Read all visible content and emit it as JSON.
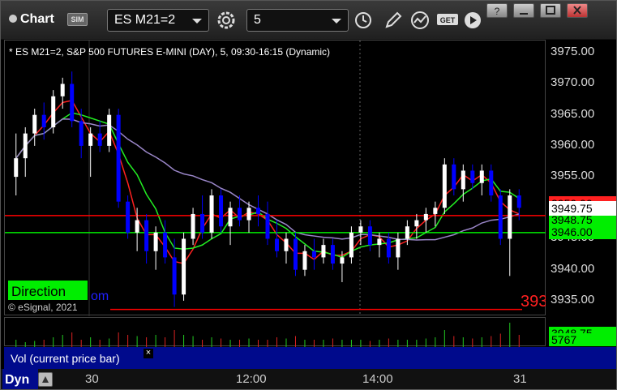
{
  "toolbar": {
    "title": "Chart",
    "sim_badge": "SIM",
    "symbol": "ES M21=2",
    "interval": "5",
    "get_label": "GET"
  },
  "chart": {
    "header": "* ES M21=2, S&P 500 FUTURES E-MINI (DAY), 5, 09:30-16:15 (Dynamic)",
    "copyright": "© eSignal, 2021",
    "direction_label": "Direction",
    "partial_text": "om",
    "red_level_text": "393",
    "price_ticks": [
      "3975.00",
      "3970.00",
      "3965.00",
      "3960.00",
      "3955.00",
      "3950.00",
      "3945.00",
      "3940.00",
      "3935.00"
    ],
    "last_price": "3949.75",
    "green_level": "3946.00",
    "red_tag": "3950.00",
    "green_tag": "3948.75",
    "vol_value": "5767",
    "vol_tag_behind": "3948.75",
    "vol_legend": "Vol (current price bar)",
    "time_ticks": [
      "30",
      "12:00",
      "14:00",
      "31"
    ],
    "dyn_label": "Dyn",
    "colors": {
      "up": "#ffffff",
      "down": "#0000ff",
      "ma_red": "#ff2020",
      "ma_green": "#22ee22",
      "ma_purple": "#9a86c8",
      "level_red": "#ff0000",
      "level_green": "#00ee00"
    }
  },
  "chart_data": {
    "type": "candlestick",
    "ylim": [
      3932.5,
      3977
    ],
    "candles": [
      [
        3955,
        3962,
        3952,
        3958
      ],
      [
        3958,
        3963,
        3955,
        3962
      ],
      [
        3962,
        3966,
        3960,
        3965
      ],
      [
        3965,
        3967,
        3961,
        3963
      ],
      [
        3963,
        3969,
        3962,
        3968
      ],
      [
        3968,
        3971,
        3966,
        3970
      ],
      [
        3970,
        3972,
        3963,
        3964
      ],
      [
        3964,
        3966,
        3958,
        3960
      ],
      [
        3960,
        3963,
        3955,
        3962
      ],
      [
        3962,
        3964,
        3959,
        3960
      ],
      [
        3960,
        3966,
        3959,
        3965
      ],
      [
        3965,
        3966,
        3950,
        3951
      ],
      [
        3951,
        3952,
        3945,
        3946
      ],
      [
        3946,
        3950,
        3943,
        3948
      ],
      [
        3948,
        3949,
        3941,
        3943
      ],
      [
        3943,
        3947,
        3940,
        3946
      ],
      [
        3946,
        3948,
        3941,
        3942
      ],
      [
        3942,
        3945,
        3934,
        3936
      ],
      [
        3936,
        3946,
        3935,
        3945
      ],
      [
        3945,
        3950,
        3944,
        3949
      ],
      [
        3949,
        3952,
        3945,
        3946
      ],
      [
        3946,
        3953,
        3945,
        3952
      ],
      [
        3952,
        3953,
        3946,
        3947
      ],
      [
        3947,
        3951,
        3944,
        3950
      ],
      [
        3950,
        3952,
        3947,
        3948
      ],
      [
        3948,
        3951,
        3946,
        3950
      ],
      [
        3950,
        3952,
        3947,
        3949
      ],
      [
        3949,
        3951,
        3944,
        3945
      ],
      [
        3945,
        3948,
        3942,
        3943
      ],
      [
        3943,
        3946,
        3941,
        3945
      ],
      [
        3945,
        3946,
        3939,
        3940
      ],
      [
        3940,
        3944,
        3939,
        3943
      ],
      [
        3943,
        3945,
        3940,
        3942
      ],
      [
        3942,
        3945,
        3941,
        3944
      ],
      [
        3944,
        3945,
        3940,
        3941
      ],
      [
        3941,
        3943,
        3938,
        3942
      ],
      [
        3942,
        3947,
        3941,
        3946
      ],
      [
        3946,
        3948,
        3944,
        3947
      ],
      [
        3947,
        3948,
        3943,
        3944
      ],
      [
        3944,
        3946,
        3942,
        3945
      ],
      [
        3945,
        3946,
        3941,
        3942
      ],
      [
        3942,
        3946,
        3940,
        3945
      ],
      [
        3945,
        3948,
        3944,
        3947
      ],
      [
        3947,
        3949,
        3945,
        3948
      ],
      [
        3948,
        3950,
        3946,
        3949
      ],
      [
        3949,
        3951,
        3947,
        3950
      ],
      [
        3950,
        3958,
        3949,
        3957
      ],
      [
        3957,
        3958,
        3952,
        3953
      ],
      [
        3953,
        3957,
        3951,
        3956
      ],
      [
        3956,
        3957,
        3953,
        3954
      ],
      [
        3954,
        3957,
        3952,
        3956
      ],
      [
        3956,
        3957,
        3951,
        3952
      ],
      [
        3952,
        3953,
        3944,
        3945
      ],
      [
        3945,
        3953,
        3939,
        3952
      ],
      [
        3952,
        3953,
        3948,
        3950
      ]
    ],
    "volume": [
      0.3,
      0.2,
      0.25,
      0.3,
      0.4,
      0.5,
      0.6,
      0.3,
      0.4,
      0.3,
      0.35,
      0.6,
      0.5,
      0.45,
      0.4,
      0.5,
      0.4,
      0.7,
      0.5,
      0.45,
      0.3,
      0.4,
      0.35,
      0.3,
      0.3,
      0.35,
      0.3,
      0.3,
      0.4,
      0.35,
      0.45,
      0.3,
      0.3,
      0.3,
      0.35,
      0.3,
      0.3,
      0.3,
      0.25,
      0.3,
      0.35,
      0.3,
      0.3,
      0.3,
      0.35,
      0.4,
      0.7,
      0.45,
      0.4,
      0.35,
      0.4,
      0.45,
      0.55,
      1.0,
      0.5
    ]
  }
}
